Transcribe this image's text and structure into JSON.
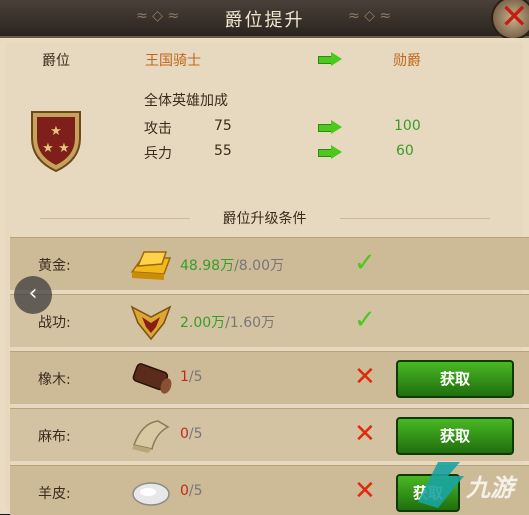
{
  "header": {
    "title": "爵位提升"
  },
  "rank": {
    "label": "爵位",
    "current": "王国骑士",
    "next": "勋爵"
  },
  "bonus": {
    "title": "全体英雄加成",
    "rows": [
      {
        "label": "攻击",
        "current": "75",
        "next": "100"
      },
      {
        "label": "兵力",
        "current": "55",
        "next": "60"
      }
    ]
  },
  "conditions": {
    "title": "爵位升级条件",
    "rows": [
      {
        "label": "黄金:",
        "have": "48.98万",
        "need": "/8.00万",
        "icon": "gold-bar-icon",
        "status": "met"
      },
      {
        "label": "战功:",
        "have": "2.00万",
        "need": "/1.60万",
        "icon": "merit-badge-icon",
        "status": "met"
      },
      {
        "label": "橡木:",
        "have": "1",
        "need": "/5",
        "icon": "oak-log-icon",
        "status": "unmet",
        "button": "获取"
      },
      {
        "label": "麻布:",
        "have": "0",
        "need": "/5",
        "icon": "linen-cloth-icon",
        "status": "unmet",
        "button": "获取"
      },
      {
        "label": "羊皮:",
        "have": "0",
        "need": "/5",
        "icon": "sheepskin-icon",
        "status": "unmet",
        "button": "获取"
      }
    ]
  },
  "watermark": {
    "text": "九游"
  },
  "colors": {
    "accent_green": "#4cc81e",
    "accent_orange": "#c0661a",
    "cross_red": "#e02a10"
  }
}
